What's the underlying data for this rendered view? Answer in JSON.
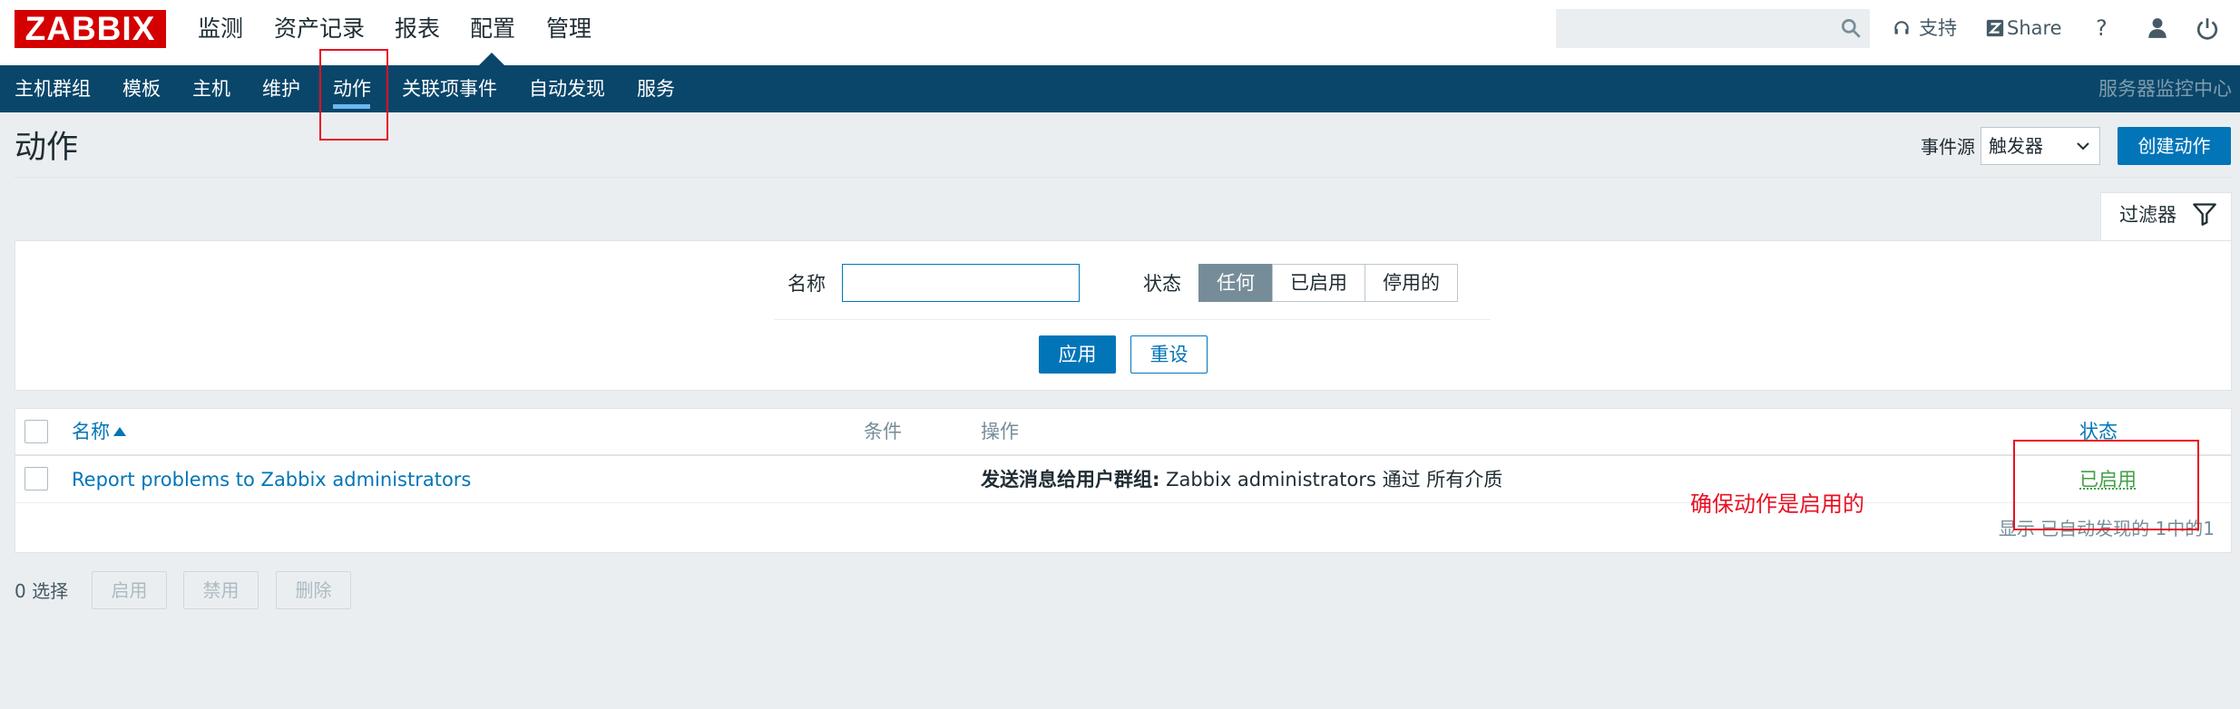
{
  "header": {
    "logo": "ZABBIX",
    "menu": [
      "监测",
      "资产记录",
      "报表",
      "配置",
      "管理"
    ],
    "active_menu": "配置",
    "search_placeholder": "",
    "support_label": "支持",
    "share_label": "Share",
    "help_label": "?"
  },
  "subnav": {
    "items": [
      "主机群组",
      "模板",
      "主机",
      "维护",
      "动作",
      "关联项事件",
      "自动发现",
      "服务"
    ],
    "active": "动作",
    "server_name": "服务器监控中心"
  },
  "page": {
    "title": "动作",
    "event_source_label": "事件源",
    "event_source_value": "触发器",
    "create_button": "创建动作"
  },
  "filter": {
    "tab_label": "过滤器",
    "name_label": "名称",
    "name_value": "",
    "status_label": "状态",
    "status_options": [
      "任何",
      "已启用",
      "停用的"
    ],
    "status_selected": "任何",
    "apply_label": "应用",
    "reset_label": "重设"
  },
  "table": {
    "columns": [
      "名称",
      "条件",
      "操作",
      "状态"
    ],
    "rows": [
      {
        "name": "Report problems to Zabbix administrators",
        "conditions": "",
        "operation_bold": "发送消息给用户群组:",
        "operation_text": " Zabbix administrators 通过 所有介质",
        "status": "已启用"
      }
    ],
    "footer": "显示 已自动发现的 1中的1"
  },
  "bulk": {
    "selected": "0 选择",
    "enable_label": "启用",
    "disable_label": "禁用",
    "delete_label": "删除"
  },
  "annotation": "确保动作是启用的",
  "colors": {
    "brand_red": "#d40000",
    "nav_bg": "#0a466a",
    "accent_blue": "#0275b8",
    "status_green": "#429e47",
    "annotation_red": "#e81123"
  }
}
